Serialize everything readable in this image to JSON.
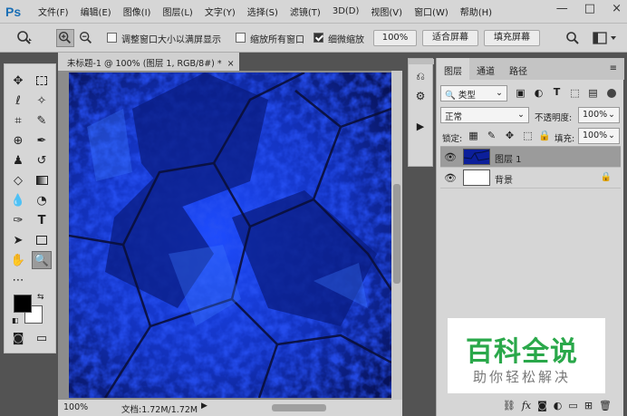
{
  "app": {
    "logo": "Ps"
  },
  "menu": [
    "文件(F)",
    "编辑(E)",
    "图像(I)",
    "图层(L)",
    "文字(Y)",
    "选择(S)",
    "滤镜(T)",
    "3D(D)",
    "视图(V)",
    "窗口(W)",
    "帮助(H)"
  ],
  "window_controls": [
    "—",
    "□",
    "×"
  ],
  "options": {
    "resize_windows_label": "调整窗口大小以满屏显示",
    "resize_windows_checked": false,
    "zoom_all_label": "缩放所有窗口",
    "zoom_all_checked": false,
    "scrubby_zoom_label": "细微缩放",
    "scrubby_zoom_checked": true,
    "zoom_percent": "100%",
    "fit_screen": "适合屏幕",
    "fill_screen": "填充屏幕"
  },
  "document": {
    "tab_title": "未标题-1 @ 100% (图层 1, RGB/8#) *",
    "close": "×",
    "status_zoom": "100%",
    "status_doc": "文档:1.72M/1.72M"
  },
  "layers_panel": {
    "tabs": [
      "图层",
      "通道",
      "路径"
    ],
    "active_tab": "图层",
    "filter_kind": "类型",
    "blend_mode": "正常",
    "opacity_label": "不透明度:",
    "opacity": "100%",
    "lock_label": "锁定:",
    "fill_label": "填充:",
    "fill": "100%",
    "layers": [
      {
        "name": "图层 1",
        "selected": true,
        "locked": false
      },
      {
        "name": "背景",
        "selected": false,
        "locked": true
      }
    ]
  },
  "watermark": {
    "title": "百科全说",
    "subtitle": "助你轻松解决"
  },
  "colors": {
    "foreground": "#000000",
    "background": "#ffffff",
    "canvas_blue": "#1a33d0",
    "brand_green": "#2aa84a"
  }
}
